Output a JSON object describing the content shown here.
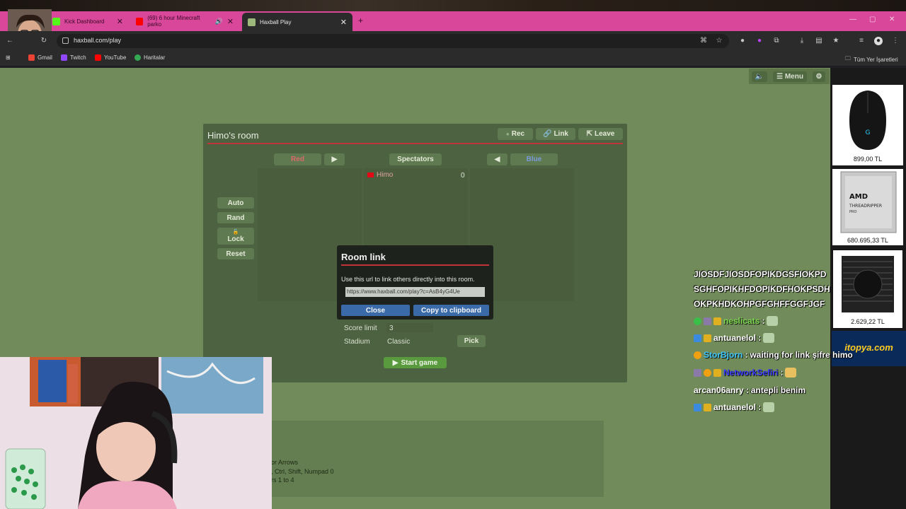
{
  "browser": {
    "tabs": [
      {
        "label": "Kick Dashboard",
        "active": false,
        "color": "#53fc18"
      },
      {
        "label": "(69) 6 hour Minecraft parko",
        "active": false,
        "color": "#ff0000"
      },
      {
        "label": "Haxball Play",
        "active": true,
        "color": "#9cb87a"
      }
    ],
    "url": "haxball.com/play",
    "bookmarks": [
      "Gmail",
      "Twitch",
      "YouTube",
      "Haritalar"
    ],
    "all_bookmarks": "Tüm Yer İşaretleri"
  },
  "game_menu": {
    "mute_icon": "speaker-icon",
    "menu_label": "Menu",
    "settings_icon": "gear-icon"
  },
  "room": {
    "title": "Himo's room",
    "rec_label": "Rec",
    "link_label": "Link",
    "leave_label": "Leave",
    "red_label": "Red",
    "spectators_label": "Spectators",
    "blue_label": "Blue",
    "side_buttons": [
      "Auto",
      "Rand",
      "Lock",
      "Reset"
    ],
    "player": {
      "name": "Himo",
      "score": "0"
    },
    "score_limit_label": "Score limit",
    "score_limit_value": "3",
    "stadium_label": "Stadium",
    "stadium_value": "Classic",
    "pick_label": "Pick",
    "start_label": "Start game"
  },
  "modal": {
    "title": "Room link",
    "description": "Use this url to link others directly into this room.",
    "url": "https://www.haxball.com/play?c=AsB4yG4Ue",
    "close_label": "Close",
    "copy_label": "Copy to clipboard"
  },
  "lower_box": {
    "lines": [
      "or Arrows",
      ", Ctrl, Shift, Numpad 0",
      "rs 1 to 4"
    ]
  },
  "chat": {
    "head_message": "JIOSDFJIOSDFOPIKDGSFIOKPDSGHFOPIKHFDOPIKDFHOKPSDHOKPKHDKOHPGFGHFFGGFJGF",
    "rows": [
      {
        "user": "neslicats",
        "color": "#7dd94f",
        "msg": ""
      },
      {
        "user": "antuanelol",
        "color": "#ffffff",
        "msg": ""
      },
      {
        "user": "StorBjorn",
        "color": "#3ec6ff",
        "msg": "waiting for link şifre himo"
      },
      {
        "user": "NetworkSefiri",
        "color": "#3a3aff",
        "msg": ""
      },
      {
        "user": "arcan06anry",
        "color": "#ffffff",
        "msg": "antepli benim"
      },
      {
        "user": "antuanelol",
        "color": "#ffffff",
        "msg": ""
      }
    ]
  },
  "ads": [
    {
      "price": "899,00 TL",
      "item": "mouse"
    },
    {
      "price": "680.695,33 TL",
      "item": "AMD THREADRIPPER PRO"
    },
    {
      "price": "2.629,22 TL",
      "item": "cpu cooler"
    }
  ],
  "ad_brand": "itopya.com"
}
